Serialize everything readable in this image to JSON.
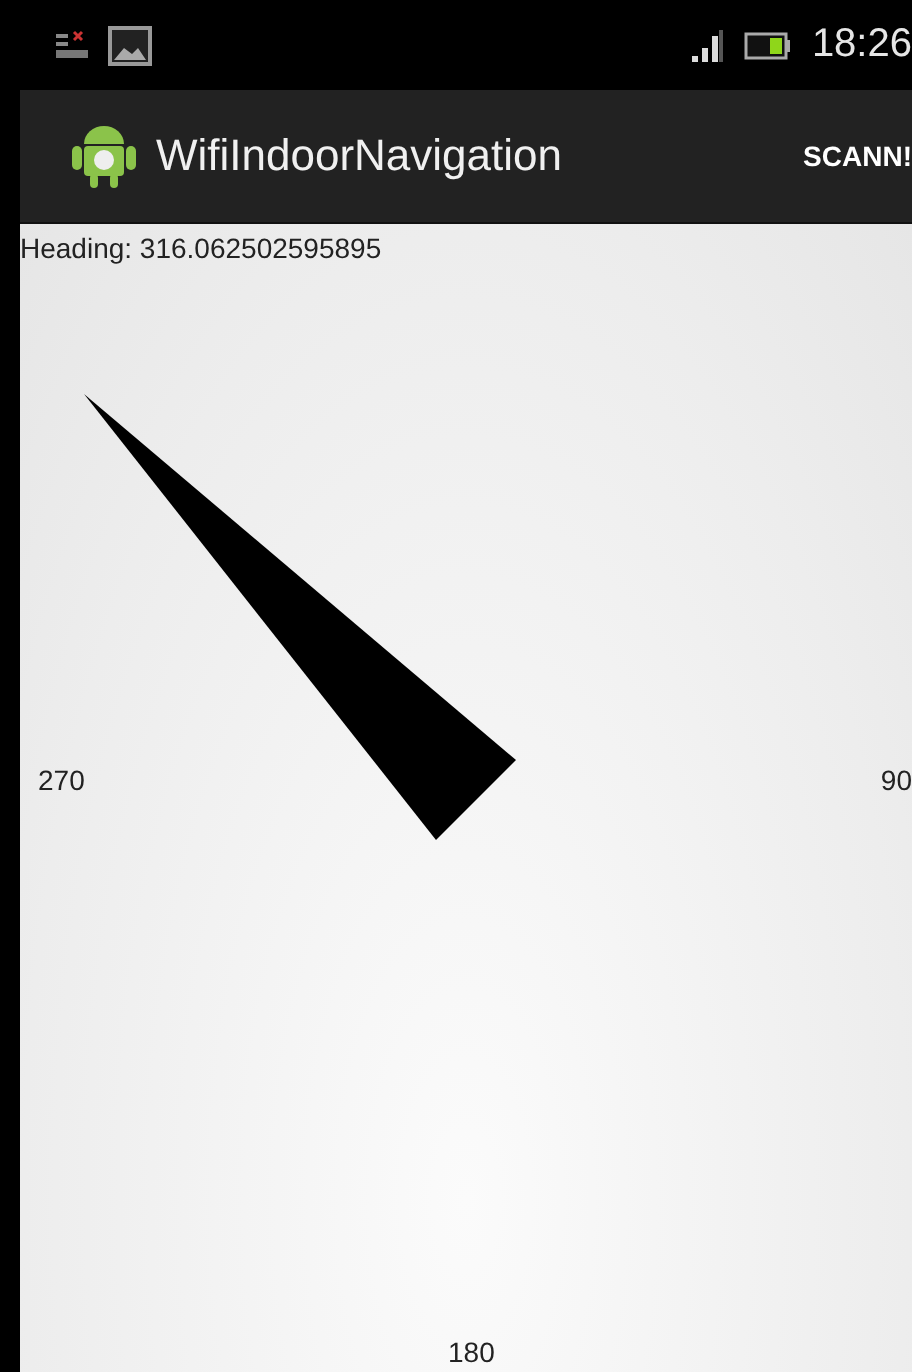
{
  "status_bar": {
    "time": "18:26"
  },
  "action_bar": {
    "title": "WifiIndoorNavigation",
    "action": "SCANN!"
  },
  "heading": "Heading: 316.062502595895",
  "compass": {
    "labels": [
      {
        "kind": "west",
        "text": "270"
      },
      {
        "kind": "east",
        "text": "90"
      },
      {
        "kind": "south",
        "text": "180"
      }
    ]
  }
}
